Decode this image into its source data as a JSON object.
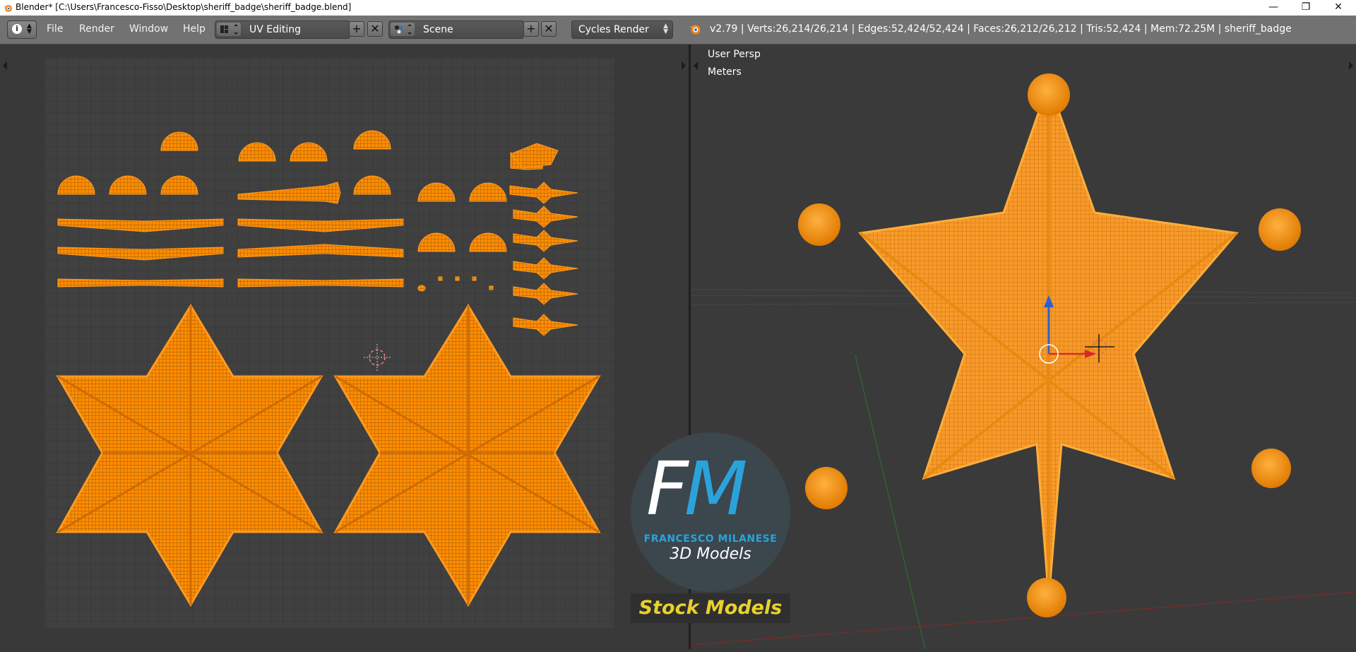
{
  "window": {
    "title": "Blender* [C:\\Users\\Francesco-Fisso\\Desktop\\sheriff_badge\\sheriff_badge.blend]",
    "minimize": "—",
    "maximize": "❐",
    "close": "✕"
  },
  "header": {
    "menus": [
      "File",
      "Render",
      "Window",
      "Help"
    ],
    "layout": "UV Editing",
    "scene": "Scene",
    "render_engine": "Cycles Render",
    "stats": "v2.79 | Verts:26,214/26,214 | Edges:52,424/52,424 | Faces:26,212/26,212 | Tris:52,424 | Mem:72.25M | sheriff_badge",
    "add_symbol": "+",
    "remove_symbol": "✕"
  },
  "viewport": {
    "view_name": "User Persp",
    "units": "Meters"
  },
  "watermark": {
    "letter_f": "F",
    "letter_m": "M",
    "name": "FRANCESCO MILANESE",
    "tagline": "3D Models",
    "banner": "Stock Models"
  },
  "colors": {
    "mesh_orange": "#ff8c00",
    "header_gray": "#727272",
    "editor_bg": "#393939",
    "logo_blue": "#2aa3db",
    "banner_yellow": "#e9d12b"
  }
}
